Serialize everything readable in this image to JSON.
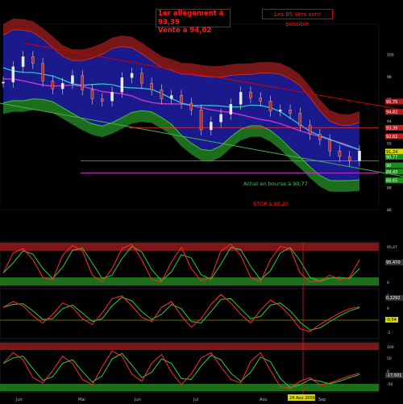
{
  "annotations": {
    "note_main_line1": "1er allègement à 93,39",
    "note_main_line2": "Vente à 94,02",
    "note_side": "Les 95 Vers sont possible",
    "buy_label": "Achat en bourse à 90,77",
    "stop_label": "STOP à 90,20"
  },
  "colors": {
    "background": "#000000",
    "price_band": "#1a1a8c",
    "upper_band": "#8b1a1a",
    "lower_band": "#1f7a1f",
    "resistance": "#cc0000",
    "support": "#4caf50",
    "ma_cyan": "#33cccc",
    "ma_magenta": "#cc33cc",
    "oscillator_fast": "#ff2a2a",
    "oscillator_slow": "#2ecc40"
  },
  "chart_data": [
    {
      "type": "line",
      "panel": "price",
      "description_type": "candlestick",
      "x_tick_labels": [
        "Jun",
        "Mai",
        "Jun",
        "Jul",
        "Aou",
        "Sep"
      ],
      "y_tick_labels": [
        "100",
        "98",
        "96",
        "94",
        "92",
        "90",
        "88",
        "86"
      ],
      "price_labels": {
        "upper_1": "95,75",
        "upper_2": "94,82",
        "upper_3": "93,39",
        "upper_4": "92,62",
        "last": "91,24",
        "lower_1": "90,77",
        "lower_2": "90",
        "lower_3": "89,43",
        "lower_4": "88,65"
      },
      "ylim": [
        86,
        102
      ],
      "last_price": 91.24,
      "series": [
        {
          "values": [
            97.5,
            98.9,
            99.8,
            99.2,
            97.6,
            96.9,
            97.4,
            98.1,
            96.8,
            96.0,
            95.8,
            96.6,
            97.9,
            98.3,
            97.4,
            96.8,
            96.0,
            96.3,
            95.6,
            95.0,
            93.2,
            93.9,
            94.6,
            95.5,
            96.6,
            96.1,
            95.8,
            94.9,
            95.0,
            94.7,
            93.6,
            92.8,
            92.3,
            91.3,
            90.8,
            90.4,
            91.3
          ]
        }
      ]
    },
    {
      "type": "line",
      "panel": "stochastic",
      "level_labels": [
        "95,47",
        "0"
      ],
      "value_label": "95,470",
      "series": [
        {
          "name": "",
          "values": [
            30,
            75,
            85,
            60,
            20,
            15,
            70,
            92,
            80,
            25,
            10,
            40,
            85,
            95,
            60,
            15,
            10,
            55,
            88,
            40,
            12,
            20,
            80,
            95,
            70,
            20,
            10,
            60,
            90,
            85,
            30,
            10,
            12,
            25,
            15,
            20,
            60
          ]
        }
      ]
    },
    {
      "type": "line",
      "panel": "momentum",
      "tick_labels": [
        "1",
        "0",
        "-1",
        "-2"
      ],
      "value_labels": [
        "0,2292",
        "-0,54"
      ],
      "series": [
        {
          "name": "",
          "values": [
            0.2,
            0.6,
            0.3,
            -0.4,
            -0.9,
            -0.3,
            0.5,
            0.2,
            -0.6,
            -1.0,
            -0.2,
            0.8,
            1.0,
            0.3,
            -0.5,
            -0.8,
            0.2,
            0.6,
            -0.4,
            -1.2,
            -0.6,
            0.4,
            1.1,
            0.5,
            -0.3,
            -0.9,
            0.0,
            0.7,
            0.3,
            -0.4,
            -1.3,
            -1.5,
            -1.0,
            -0.6,
            -0.2,
            0.1,
            0.23
          ]
        }
      ]
    },
    {
      "type": "line",
      "panel": "cycle",
      "tick_labels": [
        "100",
        "50",
        "0",
        "-50"
      ],
      "value_label": "-17,501",
      "date_marker": "24 Aou 2009",
      "series": [
        {
          "name": "",
          "values": [
            10,
            40,
            20,
            -30,
            -45,
            -10,
            30,
            10,
            -35,
            -50,
            0,
            45,
            30,
            -20,
            -40,
            10,
            35,
            -15,
            -50,
            -20,
            25,
            40,
            0,
            -35,
            -45,
            15,
            40,
            -10,
            -55,
            -60,
            -40,
            -30,
            -50,
            -45,
            -35,
            -25,
            -17.5
          ]
        }
      ]
    }
  ]
}
